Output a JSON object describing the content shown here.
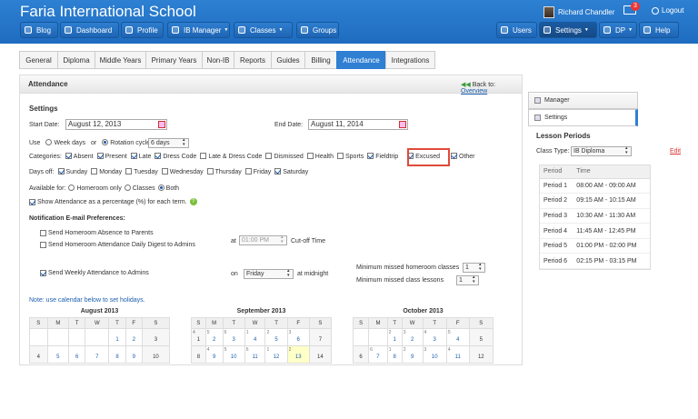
{
  "header": {
    "school_name": "Faria International School",
    "user_name": "Richard Chandler",
    "mail_count": "3",
    "logout_label": "Logout"
  },
  "nav_left": [
    {
      "label": "Blog",
      "icon": "blog-icon"
    },
    {
      "label": "Dashboard",
      "icon": "dashboard-icon"
    },
    {
      "label": "Profile",
      "icon": "profile-icon"
    },
    {
      "label": "IB Manager",
      "icon": "ib-icon"
    },
    {
      "label": "Classes",
      "icon": "classes-icon"
    },
    {
      "label": "Groups",
      "icon": "groups-icon"
    }
  ],
  "nav_right": [
    {
      "label": "Users",
      "icon": "users-icon"
    },
    {
      "label": "Settings",
      "icon": "gear-icon"
    },
    {
      "label": "DP",
      "icon": "dp-icon"
    },
    {
      "label": "Help",
      "icon": "help-icon"
    }
  ],
  "tabs": [
    "General",
    "Diploma",
    "Middle Years",
    "Primary Years",
    "Non-IB",
    "Reports",
    "Guides",
    "Billing",
    "Attendance",
    "Integrations"
  ],
  "active_tab": "Attendance",
  "panel": {
    "title": "Attendance",
    "back_label": "Back to:",
    "back_link": "Overview"
  },
  "settings": {
    "heading": "Settings",
    "start_label": "Start Date:",
    "start_value": "August 12, 2013",
    "end_label": "End Date:",
    "end_value": "August 11, 2014",
    "use_label": "Use",
    "weekdays_label": "Week days",
    "or_label": "or",
    "rotation_label": "Rotation cycle",
    "rotation_value": "6 days",
    "categories_label": "Categories:",
    "categories": [
      {
        "label": "Absent",
        "checked": true
      },
      {
        "label": "Present",
        "checked": true
      },
      {
        "label": "Late",
        "checked": true
      },
      {
        "label": "Dress Code",
        "checked": true
      },
      {
        "label": "Late & Dress Code",
        "checked": false
      },
      {
        "label": "Dismissed",
        "checked": false
      },
      {
        "label": "Health",
        "checked": false
      },
      {
        "label": "Sports",
        "checked": false
      },
      {
        "label": "Fieldtrip",
        "checked": true
      },
      {
        "label": "Excused",
        "checked": true
      },
      {
        "label": "Other",
        "checked": true
      }
    ],
    "days_off_label": "Days off:",
    "days_off": [
      {
        "label": "Sunday",
        "checked": true
      },
      {
        "label": "Monday",
        "checked": false
      },
      {
        "label": "Tuesday",
        "checked": false
      },
      {
        "label": "Wednesday",
        "checked": false
      },
      {
        "label": "Thursday",
        "checked": false
      },
      {
        "label": "Friday",
        "checked": false
      },
      {
        "label": "Saturday",
        "checked": true
      }
    ],
    "available_label": "Available for:",
    "available_homeroom": "Homeroom only",
    "available_classes": "Classes",
    "available_both": "Both",
    "show_percentage": "Show Attendance as a percentage (%) for each term.",
    "help_glyph": "?"
  },
  "notification": {
    "heading": "Notification E-mail Preferences:",
    "absence_parents": "Send Homeroom Absence to Parents",
    "digest_admins": "Send Homeroom Attendance Daily Digest to Admins",
    "at_label": "at",
    "cutoff_value": "01:00 PM",
    "cutoff_label": "Cut-off Time",
    "weekly_admins": "Send Weekly Attendance to Admins",
    "on_label": "on",
    "weekly_day": "Friday",
    "midnight_label": "at midnight",
    "min_homeroom_label": "Minimum missed homeroom classes",
    "min_homeroom_value": "1",
    "min_lessons_label": "Minimum missed class lessons",
    "min_lessons_value": "1"
  },
  "holiday_note": "Note: use calendar below to set holidays.",
  "calendars": [
    {
      "month": "August 2013",
      "weekdays": [
        "S",
        "M",
        "T",
        "W",
        "T",
        "F",
        "S"
      ],
      "rows": [
        [
          {
            "d": ""
          },
          {
            "d": ""
          },
          {
            "d": ""
          },
          {
            "d": ""
          },
          {
            "d": "1"
          },
          {
            "d": "2"
          },
          {
            "d": "3",
            "we": true
          }
        ],
        [
          {
            "d": "4",
            "we": true
          },
          {
            "d": "5"
          },
          {
            "d": "6"
          },
          {
            "d": "7"
          },
          {
            "d": "8"
          },
          {
            "d": "9"
          },
          {
            "d": "10",
            "we": true
          }
        ]
      ]
    },
    {
      "month": "September 2013",
      "weekdays": [
        "S",
        "M",
        "T",
        "W",
        "T",
        "F",
        "S"
      ],
      "rows": [
        [
          {
            "d": "1",
            "we": true,
            "s": "4"
          },
          {
            "d": "2",
            "s": "5"
          },
          {
            "d": "3",
            "s": "6"
          },
          {
            "d": "4",
            "s": "1"
          },
          {
            "d": "5",
            "s": "2"
          },
          {
            "d": "6",
            "s": "3"
          },
          {
            "d": "7",
            "we": true
          }
        ],
        [
          {
            "d": "8",
            "we": true
          },
          {
            "d": "9",
            "s": "4"
          },
          {
            "d": "10",
            "s": "5"
          },
          {
            "d": "11",
            "s": "6"
          },
          {
            "d": "12",
            "s": "1"
          },
          {
            "d": "13",
            "today": true,
            "s": "2"
          },
          {
            "d": "14",
            "we": true
          }
        ]
      ]
    },
    {
      "month": "October 2013",
      "weekdays": [
        "S",
        "M",
        "T",
        "W",
        "T",
        "F",
        "S"
      ],
      "rows": [
        [
          {
            "d": ""
          },
          {
            "d": ""
          },
          {
            "d": "1",
            "s": "2"
          },
          {
            "d": "2",
            "s": "3"
          },
          {
            "d": "3",
            "s": "4"
          },
          {
            "d": "4",
            "s": "5"
          },
          {
            "d": "5",
            "we": true
          }
        ],
        [
          {
            "d": "6",
            "we": true
          },
          {
            "d": "7",
            "s": "6"
          },
          {
            "d": "8",
            "s": "1"
          },
          {
            "d": "9",
            "s": "2"
          },
          {
            "d": "10",
            "s": "3"
          },
          {
            "d": "11",
            "s": "4"
          },
          {
            "d": "12",
            "we": true
          }
        ]
      ]
    }
  ],
  "sidebar": {
    "manager_label": "Manager",
    "settings_label": "Settings"
  },
  "lesson_periods": {
    "title": "Lesson Periods",
    "class_type_label": "Class Type:",
    "class_type_value": "IB Diploma",
    "edit_label": "Edit",
    "columns": [
      "Period",
      "Time"
    ],
    "rows": [
      [
        "Period 1",
        "08:00 AM - 09:00 AM"
      ],
      [
        "Period 2",
        "09:15 AM - 10:15 AM"
      ],
      [
        "Period 3",
        "10:30 AM - 11:30 AM"
      ],
      [
        "Period 4",
        "11:45 AM - 12:45 PM"
      ],
      [
        "Period 5",
        "01:00 PM - 02:00 PM"
      ],
      [
        "Period 6",
        "02:15 PM - 03:15 PM"
      ]
    ]
  },
  "colors": {
    "accent": "#2f7fd3",
    "highlight": "#e04a3a",
    "link": "#1c5fb0"
  }
}
